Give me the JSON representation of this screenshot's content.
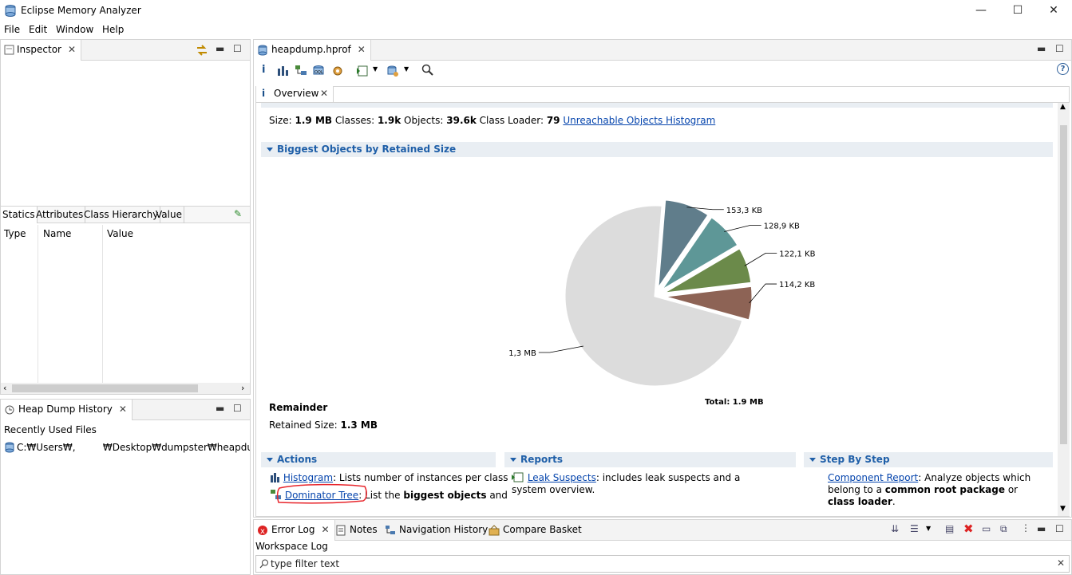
{
  "window": {
    "title": "Eclipse Memory Analyzer",
    "minimize": "—",
    "maximize": "☐",
    "close": "✕"
  },
  "menu": [
    "File",
    "Edit",
    "Window",
    "Help"
  ],
  "left": {
    "inspector_tab": "Inspector",
    "inspector_tabs": [
      "Statics",
      "Attributes",
      "Class Hierarchy",
      "Value"
    ],
    "columns": [
      "Type",
      "Name",
      "Value"
    ],
    "history_tab": "Heap Dump History",
    "recently_used": "Recently Used Files",
    "recent_file": "C:₩Users₩,         ₩Desktop₩dumpster₩heapdump.hprof"
  },
  "editor": {
    "tab": "heapdump.hprof",
    "subtab": "Overview",
    "summary": {
      "size_label": "Size:",
      "size_value": "1.9 MB",
      "classes_label": "Classes:",
      "classes_value": "1.9k",
      "objects_label": "Objects:",
      "objects_value": "39.6k",
      "loader_label": "Class Loader:",
      "loader_value": "79",
      "link": "Unreachable Objects Histogram"
    },
    "biggest_title": "Biggest Objects by Retained Size",
    "remainder_title": "Remainder",
    "retained_label": "Retained Size:",
    "retained_value": "1.3 MB",
    "actions": {
      "title": "Actions",
      "histogram_link": "Histogram",
      "histogram_text": ": Lists number of instances per class",
      "dominator_link": "Dominator Tree",
      "dominator_text_a": ": List the ",
      "dominator_bold": "biggest objects",
      "dominator_text_b": " and"
    },
    "reports": {
      "title": "Reports",
      "leak_link": "Leak Suspects",
      "leak_text": ": includes leak suspects and a system overview."
    },
    "steps": {
      "title": "Step By Step",
      "component_link": "Component Report",
      "component_text_a": ": Analyze objects which belong to a ",
      "component_bold_a": "common root package",
      "component_text_b": " or ",
      "component_bold_b": "class loader",
      "component_text_c": "."
    }
  },
  "chart_data": {
    "type": "pie",
    "title": "",
    "total_label": "Total: 1.9 MB",
    "slices": [
      {
        "label": "153,3 KB",
        "value": 153.3,
        "color": "#607d8b"
      },
      {
        "label": "128,9 KB",
        "value": 128.9,
        "color": "#5e9797"
      },
      {
        "label": "122,1 KB",
        "value": 122.1,
        "color": "#6b8a4a"
      },
      {
        "label": "114,2 KB",
        "value": 114.2,
        "color": "#8d6355"
      },
      {
        "label": "1,3 MB",
        "value": 1331,
        "color": "#dcdcdc"
      }
    ]
  },
  "bottom": {
    "tabs": [
      "Error Log",
      "Notes",
      "Navigation History",
      "Compare Basket"
    ],
    "workspace": "Workspace Log",
    "filter_placeholder": "type filter text"
  },
  "colors": {
    "accent": "#1f5fa8",
    "section_bg": "#e9eef3",
    "annotation": "#e8262c"
  }
}
